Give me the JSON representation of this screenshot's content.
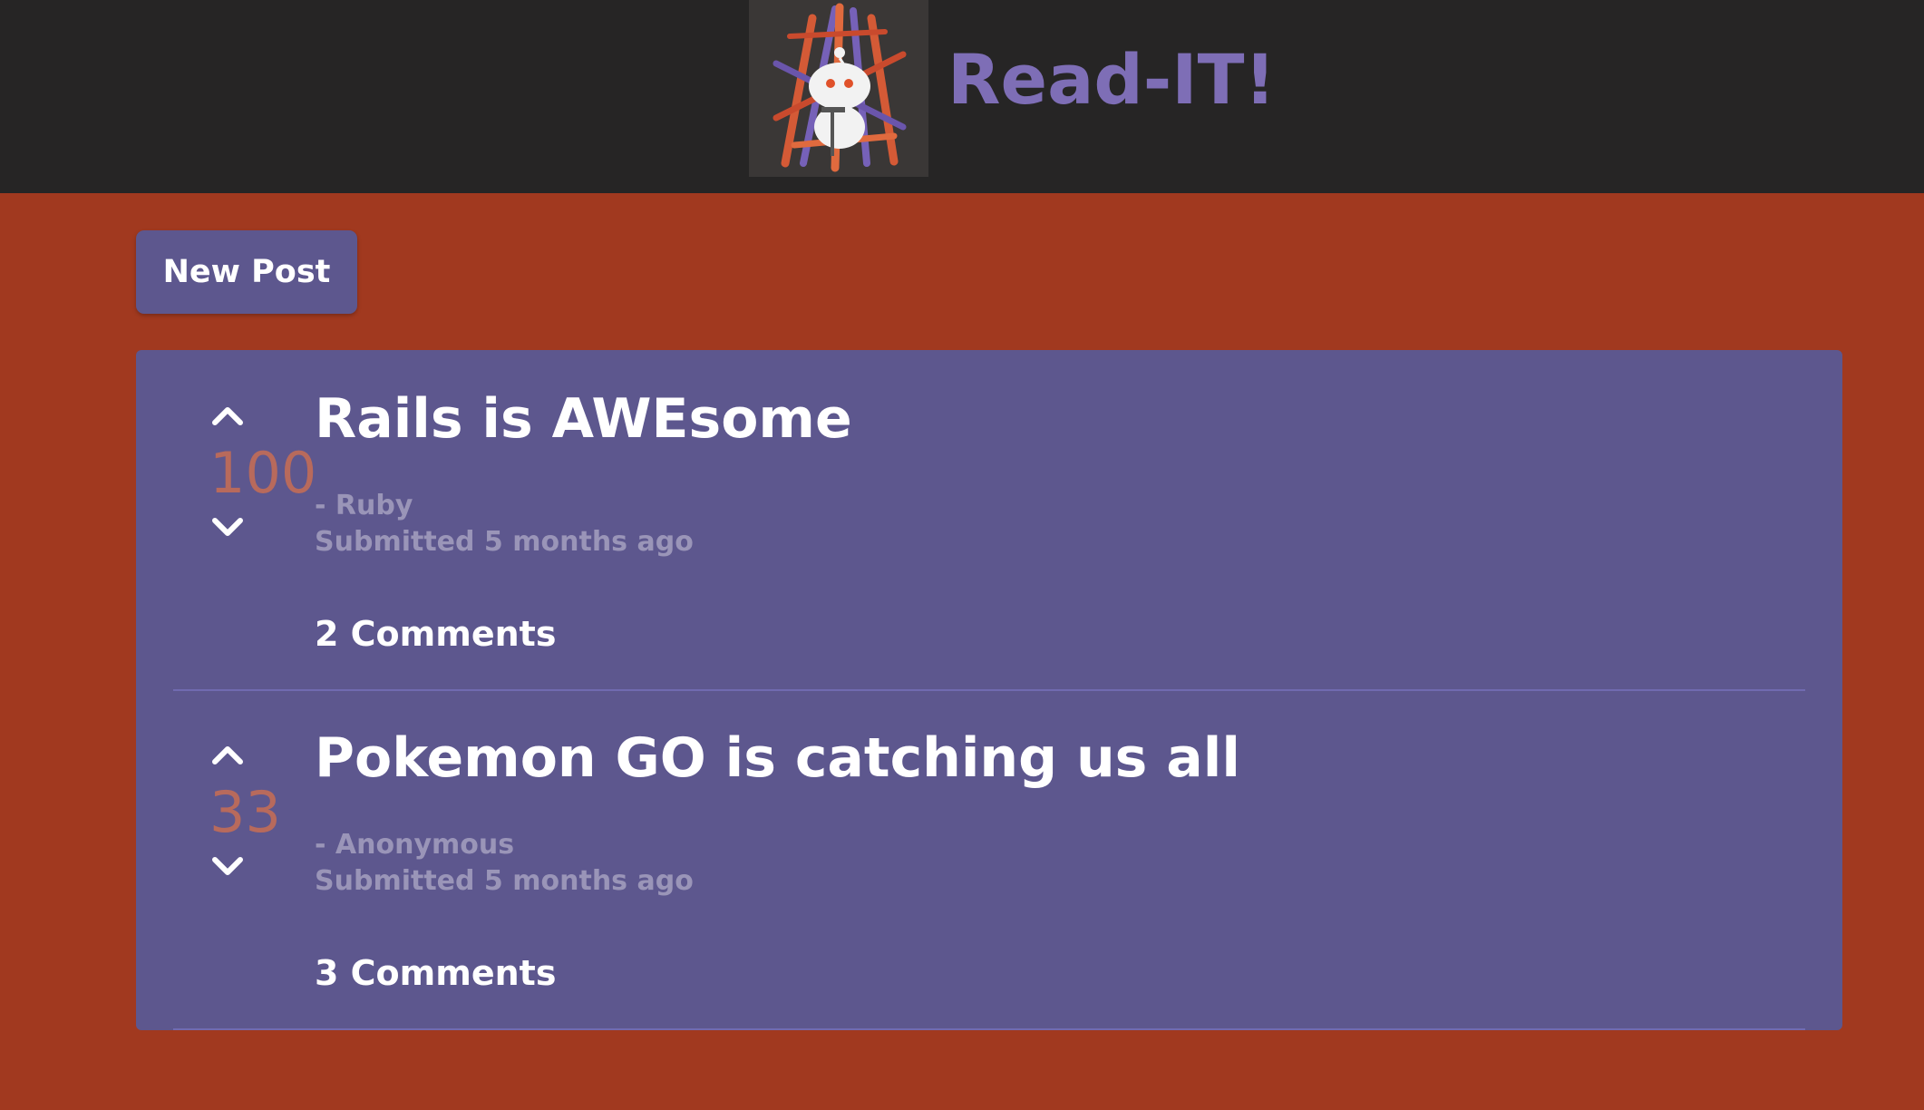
{
  "header": {
    "title": "Read-IT!",
    "logo_icon": "reddit-alien-throne-logo"
  },
  "toolbar": {
    "new_post_label": "New Post"
  },
  "colors": {
    "page_background": "#a1391f",
    "header_background": "#262525",
    "panel_background": "#5d578e",
    "title_purple": "#7e6eb6",
    "score_color": "#b86a5c",
    "meta_color": "#9a95b8"
  },
  "posts": [
    {
      "score": "100",
      "title": "Rails is AWEsome",
      "author": "- Ruby",
      "submitted": "Submitted 5 months ago",
      "comments": "2 Comments"
    },
    {
      "score": "33",
      "title": "Pokemon GO is catching us all",
      "author": "- Anonymous",
      "submitted": "Submitted 5 months ago",
      "comments": "3 Comments"
    }
  ]
}
